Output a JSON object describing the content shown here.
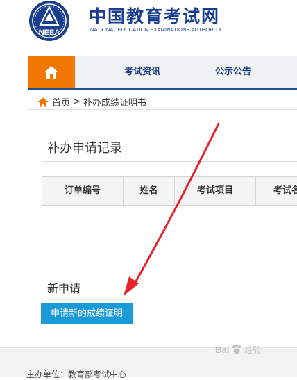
{
  "header": {
    "logo_text": "NEEA",
    "title": "中国教育考试网",
    "subtitle": "NATIONAL EDUCATION EXAMINATIONS AUTHORITY"
  },
  "nav": {
    "items": [
      {
        "label": "考试资讯"
      },
      {
        "label": "公示公告"
      }
    ]
  },
  "breadcrumb": {
    "home": "首页",
    "separator": ">",
    "current": "补办成绩证明书"
  },
  "records": {
    "title": "补办申请记录",
    "columns": [
      "订单编号",
      "姓名",
      "考试项目",
      "考试名"
    ]
  },
  "new_request": {
    "title": "新申请",
    "button_label": "申请新的成绩证明"
  },
  "footer": {
    "text": "主办单位：教育部考试中心"
  },
  "watermark": {
    "brand": "Bai",
    "suffix": "经验"
  },
  "colors": {
    "accent_orange": "#f07800",
    "brand_blue": "#1b3f8f",
    "button_blue": "#1a9ad7",
    "arrow_red": "#e8212a"
  }
}
